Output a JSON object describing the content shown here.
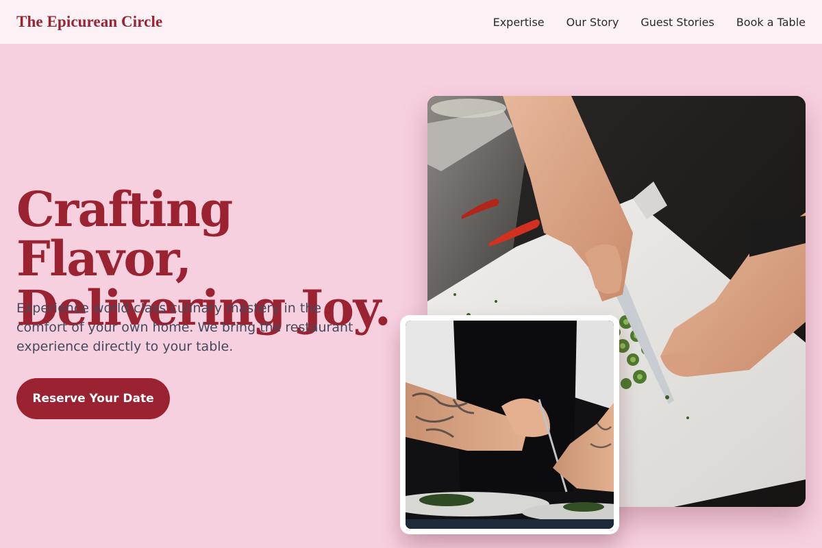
{
  "header": {
    "brand": "The Epicurean Circle",
    "nav": [
      "Expertise",
      "Our Story",
      "Guest Stories",
      "Book a Table"
    ]
  },
  "hero": {
    "title_line1": "Crafting Flavor,",
    "title_line2": "Delivering Joy.",
    "subtitle": "Experience world-class culinary mastery in the comfort of your own home. We bring the restaurant experience directly to your table.",
    "cta_label": "Reserve Your Date"
  },
  "images": {
    "main": "chef-chopping-vegetables-photo",
    "secondary": "chef-plating-dish-photo"
  },
  "colors": {
    "background": "#f7d0e0",
    "header_bg": "#fcf2f6",
    "brand": "#9b2230",
    "body_text": "#444a5c"
  }
}
